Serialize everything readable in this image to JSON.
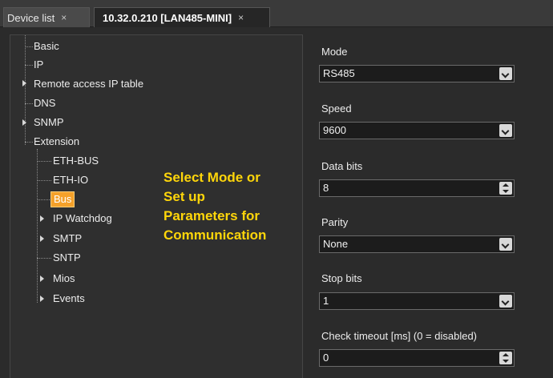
{
  "tabs": [
    {
      "label": "Device list",
      "close": "×"
    },
    {
      "label": "10.32.0.210 [LAN485-MINI]",
      "close": "×"
    }
  ],
  "tree": {
    "basic": "Basic",
    "ip": "IP",
    "remote": "Remote access IP table",
    "dns": "DNS",
    "snmp": "SNMP",
    "extension": "Extension",
    "ethbus": "ETH-BUS",
    "ethio": "ETH-IO",
    "bus": "Bus",
    "ipwatchdog": "IP Watchdog",
    "smtp": "SMTP",
    "sntp": "SNTP",
    "mios": "Mios",
    "events": "Events"
  },
  "annotation": {
    "line1": "Select Mode or",
    "line2": "Set up",
    "line3": "Parameters for",
    "line4": "Communication"
  },
  "form": {
    "mode": {
      "label": "Mode",
      "value": "RS485"
    },
    "speed": {
      "label": "Speed",
      "value": "9600"
    },
    "databits": {
      "label": "Data bits",
      "value": "8"
    },
    "parity": {
      "label": "Parity",
      "value": "None"
    },
    "stopbits": {
      "label": "Stop bits",
      "value": "1"
    },
    "timeout": {
      "label": "Check timeout [ms] (0 = disabled)",
      "value": "0"
    }
  }
}
